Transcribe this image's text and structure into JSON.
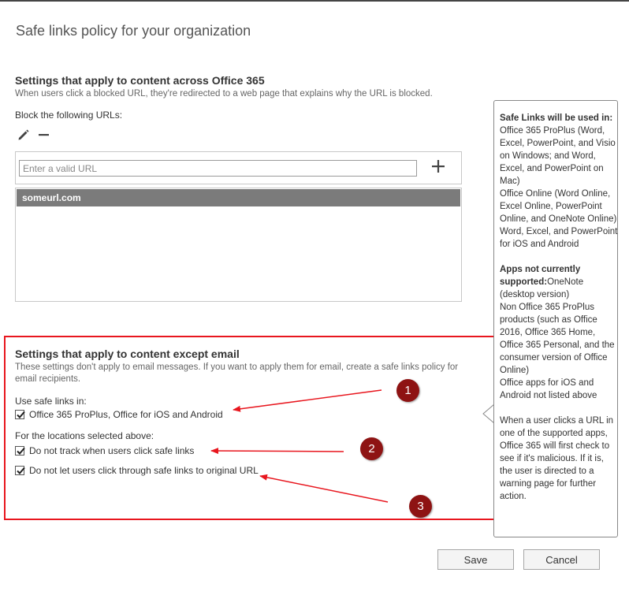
{
  "page": {
    "title": "Safe links policy for your organization"
  },
  "office365_section": {
    "title": "Settings that apply to content across Office 365",
    "description": "When users click a blocked URL, they're redirected to a web page that explains why the URL is blocked.",
    "block_label": "Block the following URLs:",
    "url_input_placeholder": "Enter a valid URL",
    "url_input_value": "",
    "blocked_urls": [
      "someurl.com"
    ]
  },
  "except_email_section": {
    "title": "Settings that apply to content except email",
    "description": "These settings don't apply to email messages. If you want to apply them for email, create a safe links policy for email recipients.",
    "use_in_label": "Use safe links in:",
    "use_in_option": {
      "label": "Office 365 ProPlus, Office for iOS and Android",
      "checked": true
    },
    "locations_label": "For the locations selected above:",
    "options": [
      {
        "label": "Do not track when users click safe links",
        "checked": true
      },
      {
        "label": "Do not let users click through safe links to original URL",
        "checked": true
      }
    ]
  },
  "callout": {
    "heading1": "Safe Links will be used in:",
    "para1": "Office 365 ProPlus (Word, Excel, PowerPoint, and Visio on Windows; and Word, Excel, and PowerPoint on Mac)",
    "para2": "Office Online (Word Online, Excel Online, PowerPoint Online, and OneNote Online)",
    "para3": "Word, Excel, and PowerPoint for iOS and Android",
    "heading2": "Apps not currently supported:",
    "para4_inline": "OneNote (desktop version)",
    "para5": "Non Office 365 ProPlus products (such as Office 2016, Office 365 Home, Office 365 Personal, and the consumer version of Office Online)",
    "para6": "Office apps for iOS and Android not listed above",
    "para7": "When a user clicks a URL in one of the supported apps, Office 365 will first check to see if it's malicious. If it is, the user is directed to a warning page for further action."
  },
  "annotations": {
    "badge1": "1",
    "badge2": "2",
    "badge3": "3"
  },
  "buttons": {
    "save": "Save",
    "cancel": "Cancel"
  },
  "colors": {
    "annotation_red": "#e8161e",
    "badge_fill": "#8e1313",
    "selected_row": "#7b7b7b"
  },
  "icons": {
    "edit": "pencil-icon",
    "remove": "minus-icon",
    "add": "plus-icon",
    "check": "checkmark-icon"
  }
}
